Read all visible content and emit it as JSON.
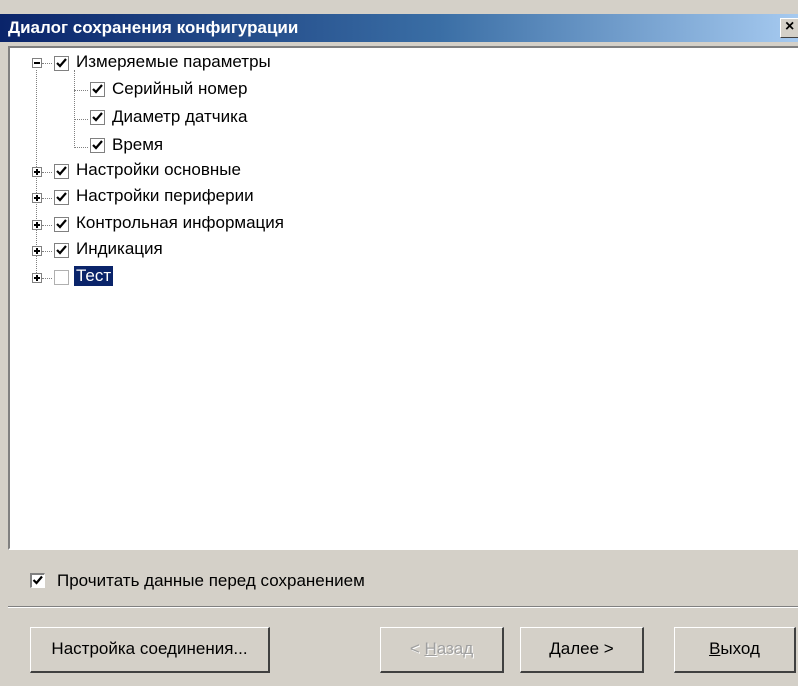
{
  "window": {
    "title": "Диалог сохранения конфигурации",
    "close_glyph": "×"
  },
  "tree": {
    "nodes": [
      {
        "label": "Измеряемые параметры",
        "checked": true,
        "expanded": true
      },
      {
        "label": "Серийный номер",
        "checked": true
      },
      {
        "label": "Диаметр датчика",
        "checked": true
      },
      {
        "label": "Время",
        "checked": true
      },
      {
        "label": "Настройки основные",
        "checked": true,
        "expanded": false
      },
      {
        "label": "Настройки периферии",
        "checked": true,
        "expanded": false
      },
      {
        "label": "Контрольная информация",
        "checked": true,
        "expanded": false
      },
      {
        "label": "Индикация",
        "checked": true,
        "expanded": false
      },
      {
        "label": "Тест",
        "checked": false,
        "expanded": false,
        "selected": true
      }
    ]
  },
  "options": {
    "read_before_save_label": "Прочитать данные перед сохранением",
    "read_before_save_checked": true
  },
  "buttons": {
    "connection_settings": "Настройка соединения...",
    "back_prefix": "< ",
    "back_mnemonic": "Н",
    "back_rest": "азад",
    "next_mnemonic": "Д",
    "next_rest": "алее >",
    "exit_mnemonic": "В",
    "exit_rest": "ыход"
  },
  "colors": {
    "titlebar_start": "#0a246a",
    "titlebar_end": "#a6caf0",
    "selection": "#0a246a",
    "face": "#d4d0c8"
  }
}
